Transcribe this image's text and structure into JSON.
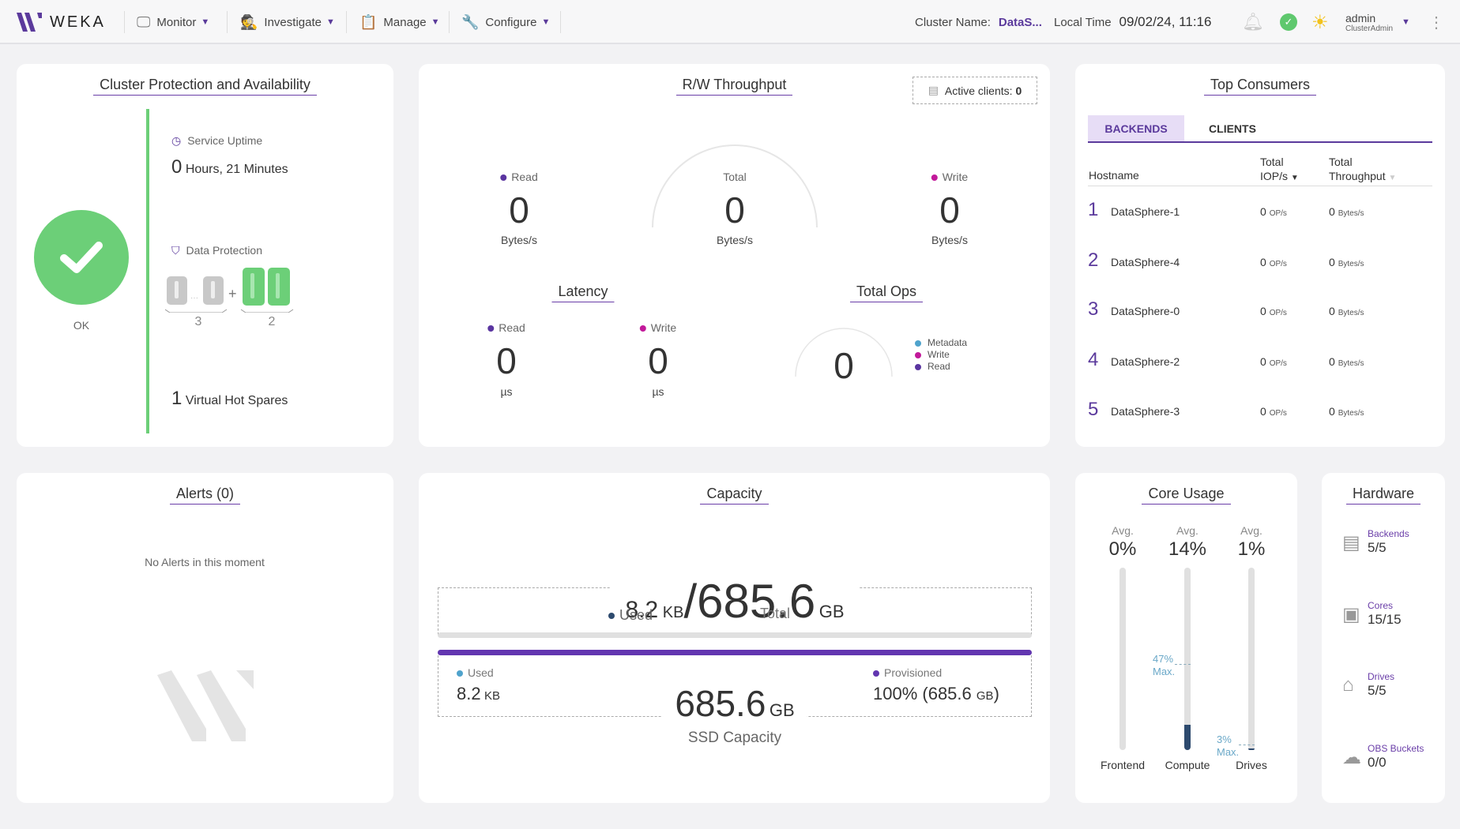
{
  "header": {
    "logo": "WEKA",
    "nav": [
      {
        "label": "Monitor",
        "icon": "monitor-icon"
      },
      {
        "label": "Investigate",
        "icon": "detective-icon"
      },
      {
        "label": "Manage",
        "icon": "clipboard-gear-icon"
      },
      {
        "label": "Configure",
        "icon": "wrench-icon"
      }
    ],
    "cluster_name_label": "Cluster Name:",
    "cluster_name": "DataS...",
    "local_time_label": "Local Time",
    "local_time": "09/02/24, 11:16",
    "user": "admin",
    "role": "ClusterAdmin"
  },
  "protection": {
    "title": "Cluster Protection and Availability",
    "status": "OK",
    "uptime_label": "Service Uptime",
    "uptime_value": "0",
    "uptime_text": "Hours, 21 Minutes",
    "data_protection_label": "Data Protection",
    "data_stripes": "3",
    "protection_stripes": "2",
    "hot_spares_value": "1",
    "hot_spares_text": "Virtual Hot Spares"
  },
  "throughput": {
    "title": "R/W Throughput",
    "active_clients_label": "Active clients:",
    "active_clients": "0",
    "read_label": "Read",
    "read_value": "0",
    "read_unit": "Bytes/s",
    "total_label": "Total",
    "total_value": "0",
    "total_unit": "Bytes/s",
    "write_label": "Write",
    "write_value": "0",
    "write_unit": "Bytes/s",
    "latency_title": "Latency",
    "lat_read_label": "Read",
    "lat_read_value": "0",
    "lat_read_unit": "µs",
    "lat_write_label": "Write",
    "lat_write_value": "0",
    "lat_write_unit": "µs",
    "ops_title": "Total Ops",
    "ops_value": "0",
    "ops_legend": [
      {
        "label": "Metadata",
        "color": "#4fa3cc"
      },
      {
        "label": "Write",
        "color": "#c2199a"
      },
      {
        "label": "Read",
        "color": "#5a35a0"
      }
    ],
    "colors": {
      "read": "#5a35a0",
      "write": "#c2199a"
    }
  },
  "consumers": {
    "title": "Top Consumers",
    "tabs": [
      "BACKENDS",
      "CLIENTS"
    ],
    "active_tab": "BACKENDS",
    "columns": [
      "Hostname",
      "Total IOP/s",
      "Total Throughput"
    ],
    "rows": [
      {
        "rank": "1",
        "host": "DataSphere-1",
        "iops": "0",
        "iops_unit": "OP/s",
        "tp": "0",
        "tp_unit": "Bytes/s"
      },
      {
        "rank": "2",
        "host": "DataSphere-4",
        "iops": "0",
        "iops_unit": "OP/s",
        "tp": "0",
        "tp_unit": "Bytes/s"
      },
      {
        "rank": "3",
        "host": "DataSphere-0",
        "iops": "0",
        "iops_unit": "OP/s",
        "tp": "0",
        "tp_unit": "Bytes/s"
      },
      {
        "rank": "4",
        "host": "DataSphere-2",
        "iops": "0",
        "iops_unit": "OP/s",
        "tp": "0",
        "tp_unit": "Bytes/s"
      },
      {
        "rank": "5",
        "host": "DataSphere-3",
        "iops": "0",
        "iops_unit": "OP/s",
        "tp": "0",
        "tp_unit": "Bytes/s"
      }
    ]
  },
  "alerts": {
    "title": "Alerts (0)",
    "empty": "No Alerts in this moment"
  },
  "capacity": {
    "title": "Capacity",
    "used": "8.2",
    "used_unit": "KB",
    "total": "685.6",
    "total_unit": "GB",
    "used_label": "Used",
    "total_label": "Total",
    "ssd_used_label": "Used",
    "ssd_used": "8.2",
    "ssd_used_unit": "KB",
    "ssd_total": "685.6",
    "ssd_total_unit": "GB",
    "ssd_label": "SSD Capacity",
    "provisioned_label": "Provisioned",
    "provisioned": "100% (685.6",
    "provisioned_unit": "GB",
    "provisioned_close": ")",
    "provisioned_fraction": 1.0
  },
  "core_usage": {
    "title": "Core Usage",
    "avg_label": "Avg.",
    "max_label": "Max.",
    "columns": [
      {
        "label": "Frontend",
        "avg": "0%",
        "avg_value": 0,
        "max": null
      },
      {
        "label": "Compute",
        "avg": "14%",
        "avg_value": 14,
        "max": "47%",
        "max_value": 47
      },
      {
        "label": "Drives",
        "avg": "1%",
        "avg_value": 1,
        "max": "3%",
        "max_value": 3
      }
    ]
  },
  "hardware": {
    "title": "Hardware",
    "items": [
      {
        "label": "Backends",
        "value": "5/5",
        "icon": "server-icon"
      },
      {
        "label": "Cores",
        "value": "15/15",
        "icon": "cpu-icon"
      },
      {
        "label": "Drives",
        "value": "5/5",
        "icon": "drive-icon"
      },
      {
        "label": "OBS Buckets",
        "value": "0/0",
        "icon": "cloud-bucket-icon"
      }
    ]
  }
}
